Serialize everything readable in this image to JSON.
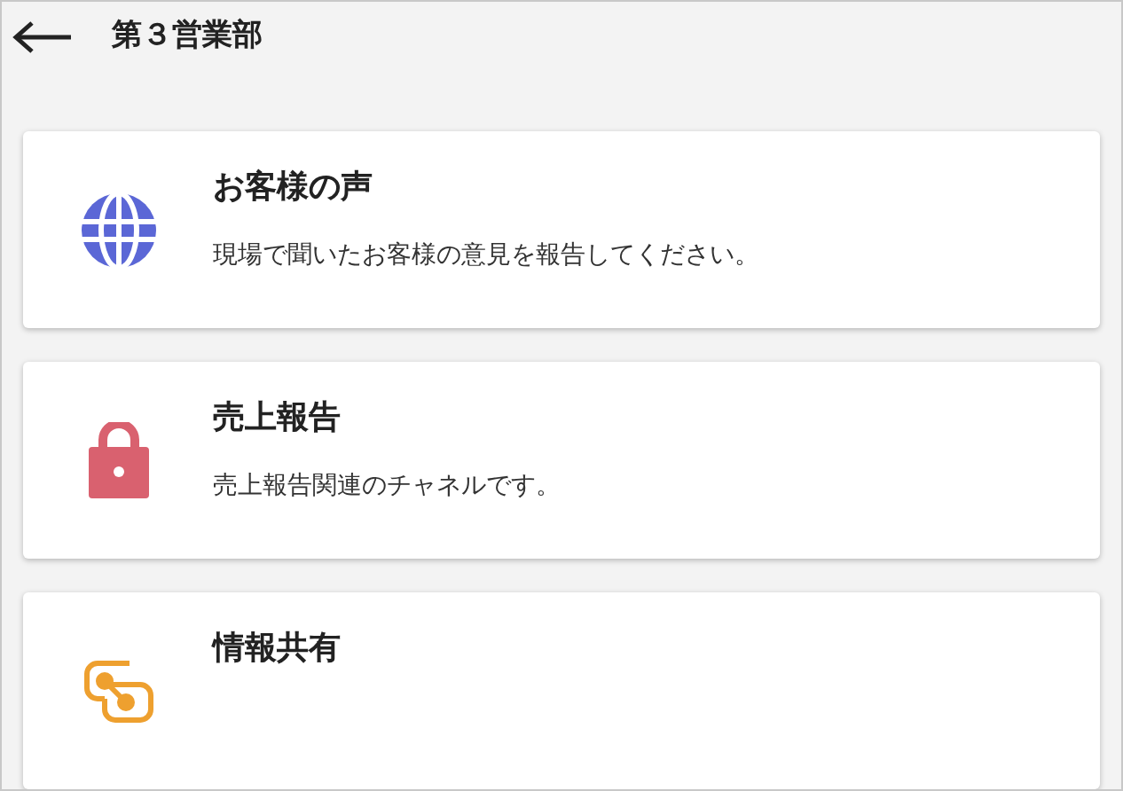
{
  "header": {
    "title": "第３営業部"
  },
  "channels": [
    {
      "kind": "globe",
      "color": "#5b67d6",
      "title": "お客様の声",
      "description": "現場で聞いたお客様の意見を報告してください。"
    },
    {
      "kind": "lock",
      "color": "#d9616f",
      "title": "売上報告",
      "description": "売上報告関連のチャネルです。"
    },
    {
      "kind": "share",
      "color": "#eea02f",
      "title": "情報共有"
    }
  ]
}
